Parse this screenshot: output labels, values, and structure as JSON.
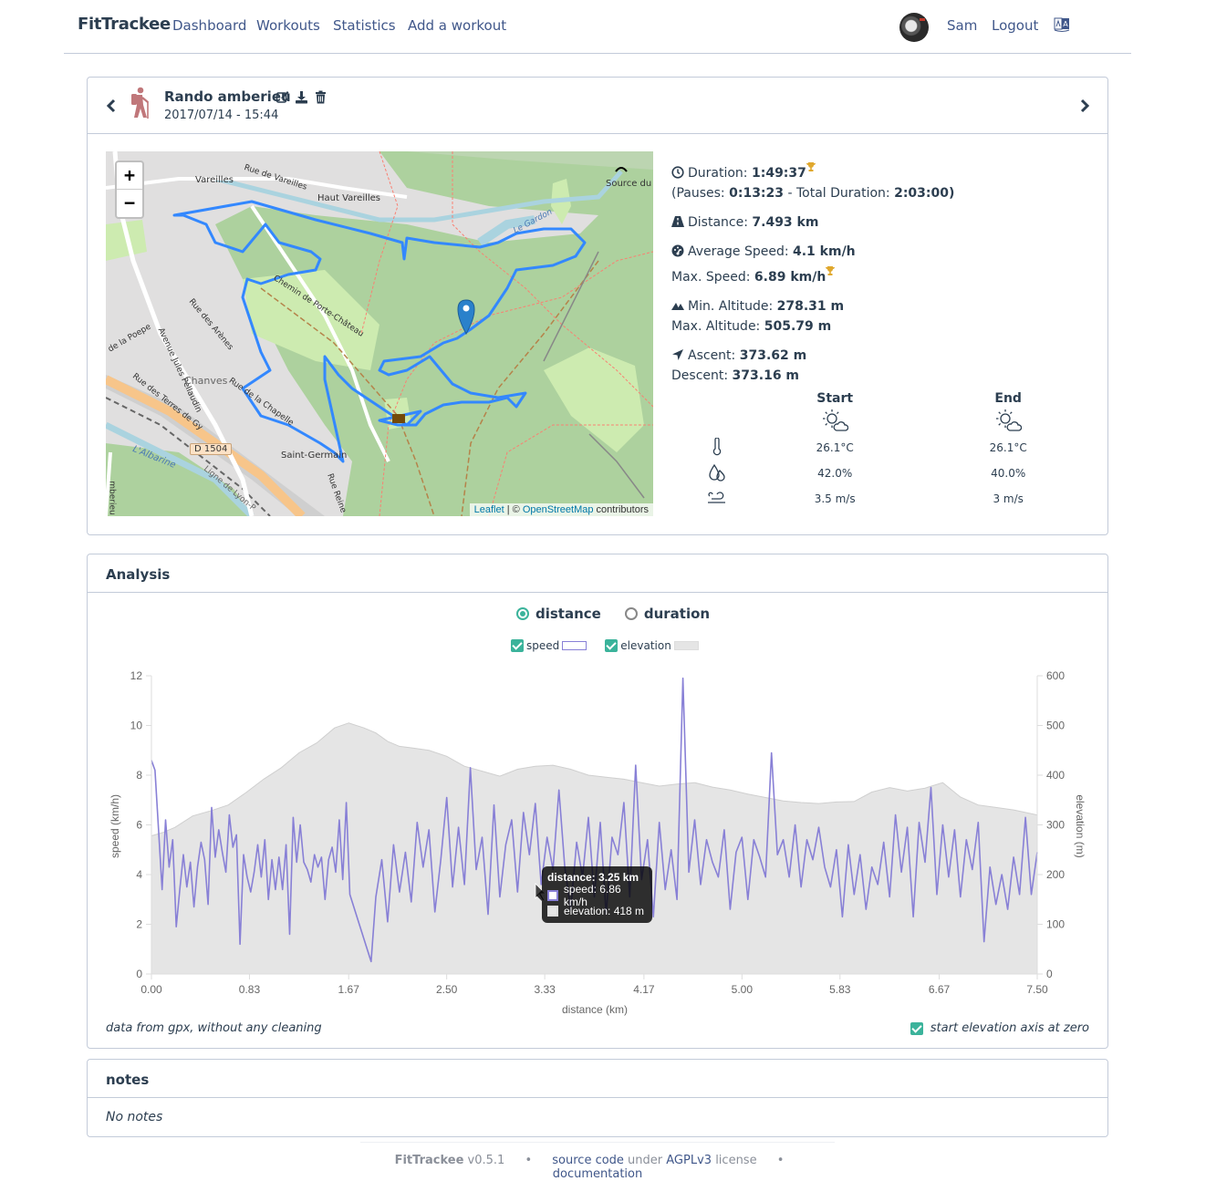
{
  "navbar": {
    "brand": "FitTrackee",
    "links": [
      "Dashboard",
      "Workouts",
      "Statistics",
      "Add a workout"
    ],
    "user": "Sam",
    "logout": "Logout",
    "language_icon": "language-icon"
  },
  "workout": {
    "title": "Rando amberieu",
    "date": "2017/07/14 - 15:44",
    "sport_icon": "hiking-icon",
    "actions": [
      "edit-icon",
      "download-icon",
      "delete-icon"
    ],
    "map": {
      "labels": [
        "Vareilles",
        "Rue de Vareilles",
        "Haut Vareilles",
        "Source du Gardon",
        "Le Gardon",
        "Chemin de Porte-Château",
        "Rue des Arènes",
        "de la Poepe",
        "Avenue Jules Pellaudin",
        "Chanves",
        "Rue des Terres de Gy",
        "Rue de la Chapelle",
        "Saint-Germain",
        "D 1504",
        "L'Albarine",
        "Ligne de Lyon-P",
        "Rue Reine",
        "mberieu"
      ],
      "zoom_in": "+",
      "zoom_out": "−",
      "attribution": {
        "leaflet": "Leaflet",
        "separator": " | © ",
        "osm": "OpenStreetMap",
        "suffix": " contributors"
      }
    },
    "stats": {
      "duration_label": "Duration: ",
      "duration": "1:49:37",
      "pauses_label": "(Pauses: ",
      "pauses": "0:13:23",
      "total_label": " - Total Duration: ",
      "total": "2:03:00",
      "close": ")",
      "distance_label": "Distance: ",
      "distance": "7.493 km",
      "avg_speed_label": "Average Speed: ",
      "avg_speed": "4.1 km/h",
      "max_speed_label": "Max. Speed: ",
      "max_speed": "6.89 km/h",
      "min_alt_label": "Min. Altitude: ",
      "min_alt": "278.31 m",
      "max_alt_label": "Max. Altitude: ",
      "max_alt": "505.79 m",
      "ascent_label": "Ascent: ",
      "ascent": "373.62 m",
      "descent_label": "Descent: ",
      "descent": "373.16 m"
    },
    "weather": {
      "start_label": "Start",
      "end_label": "End",
      "start": {
        "icon": "partly-cloudy-day-icon",
        "temperature": "26.1°C",
        "humidity": "42.0%",
        "wind": "3.5 m/s"
      },
      "end": {
        "icon": "partly-cloudy-day-icon",
        "temperature": "26.1°C",
        "humidity": "40.0%",
        "wind": "3 m/s"
      }
    }
  },
  "analysis": {
    "title": "Analysis",
    "x_modes": [
      {
        "label": "distance",
        "selected": true
      },
      {
        "label": "duration",
        "selected": false
      }
    ],
    "legend": [
      {
        "label": "speed",
        "checked": true,
        "color": "#8880d6"
      },
      {
        "label": "elevation",
        "checked": true,
        "color": "#e5e5e5"
      }
    ],
    "footnote": "data from gpx, without any cleaning",
    "elevation_zero_label": "start elevation axis at zero",
    "elevation_zero_checked": true,
    "tooltip": {
      "title": "distance: 3.25 km",
      "speed": "speed: 6.86 km/h",
      "elevation": "elevation: 418 m"
    }
  },
  "chart_data": {
    "type": "line",
    "xlabel": "distance (km)",
    "ylabel_left": "speed (km/h)",
    "ylabel_right": "elevation (m)",
    "x_ticks": [
      "0.00",
      "0.83",
      "1.67",
      "2.50",
      "3.33",
      "4.17",
      "5.00",
      "5.83",
      "6.67",
      "7.50"
    ],
    "y_left_ticks": [
      "0",
      "2",
      "4",
      "6",
      "8",
      "10",
      "12"
    ],
    "y_right_ticks": [
      "0",
      "100",
      "200",
      "300",
      "400",
      "500",
      "600"
    ],
    "xlim": [
      0,
      7.5
    ],
    "ylim_left": [
      0,
      12
    ],
    "ylim_right": [
      0,
      600
    ],
    "grid": false,
    "series": [
      {
        "name": "speed",
        "axis": "left",
        "color": "#8880d6",
        "x": [
          0,
          0.03,
          0.06,
          0.09,
          0.12,
          0.15,
          0.18,
          0.21,
          0.24,
          0.27,
          0.3,
          0.33,
          0.36,
          0.39,
          0.42,
          0.45,
          0.48,
          0.51,
          0.54,
          0.57,
          0.6,
          0.63,
          0.66,
          0.69,
          0.72,
          0.75,
          0.78,
          0.81,
          0.84,
          0.87,
          0.9,
          0.93,
          0.96,
          0.99,
          1.02,
          1.05,
          1.08,
          1.11,
          1.14,
          1.17,
          1.2,
          1.23,
          1.26,
          1.29,
          1.32,
          1.35,
          1.38,
          1.41,
          1.44,
          1.47,
          1.5,
          1.53,
          1.56,
          1.59,
          1.62,
          1.65,
          1.68,
          1.82,
          1.86,
          1.9,
          1.95,
          2.0,
          2.05,
          2.1,
          2.15,
          2.2,
          2.25,
          2.3,
          2.35,
          2.4,
          2.45,
          2.5,
          2.55,
          2.6,
          2.65,
          2.7,
          2.75,
          2.8,
          2.85,
          2.9,
          2.95,
          3.0,
          3.05,
          3.1,
          3.15,
          3.2,
          3.25,
          3.3,
          3.35,
          3.4,
          3.45,
          3.5,
          3.55,
          3.6,
          3.65,
          3.7,
          3.75,
          3.8,
          3.85,
          3.9,
          3.95,
          4.0,
          4.05,
          4.1,
          4.15,
          4.2,
          4.25,
          4.3,
          4.35,
          4.4,
          4.45,
          4.5,
          4.55,
          4.6,
          4.65,
          4.7,
          4.75,
          4.8,
          4.85,
          4.9,
          4.95,
          5.0,
          5.05,
          5.1,
          5.15,
          5.2,
          5.25,
          5.3,
          5.35,
          5.4,
          5.45,
          5.5,
          5.55,
          5.6,
          5.65,
          5.7,
          5.75,
          5.8,
          5.85,
          5.9,
          5.95,
          6.0,
          6.05,
          6.1,
          6.15,
          6.2,
          6.25,
          6.3,
          6.35,
          6.4,
          6.45,
          6.5,
          6.55,
          6.6,
          6.65,
          6.7,
          6.75,
          6.8,
          6.85,
          6.9,
          6.95,
          7.0,
          7.05,
          7.1,
          7.15,
          7.2,
          7.25,
          7.3,
          7.35,
          7.4,
          7.45,
          7.5
        ],
        "values": [
          8.6,
          8.2,
          5.8,
          3.4,
          6.2,
          4.3,
          5.4,
          1.9,
          3.4,
          4.8,
          3.5,
          4.5,
          2.7,
          4.3,
          5.3,
          4.6,
          2.8,
          6.7,
          4.7,
          5.8,
          4.9,
          4.1,
          6.4,
          5.1,
          5.6,
          1.2,
          4.8,
          3.9,
          3.3,
          4.1,
          5.2,
          3.9,
          5.4,
          3.0,
          4.6,
          3.4,
          4.7,
          3.4,
          5.2,
          1.6,
          6.3,
          4.5,
          6.0,
          4.5,
          4.2,
          3.7,
          4.8,
          4.3,
          4.7,
          3.0,
          4.6,
          5.1,
          4.1,
          6.2,
          3.8,
          6.9,
          3.2,
          1.1,
          0.5,
          3.1,
          4.6,
          2.1,
          5.2,
          3.3,
          4.9,
          2.9,
          6.1,
          4.3,
          5.8,
          2.5,
          4.6,
          7.1,
          3.5,
          5.9,
          3.6,
          8.3,
          4.2,
          5.5,
          2.4,
          6.8,
          3.1,
          5.2,
          6.2,
          3.3,
          6.5,
          4.8,
          6.86,
          3.6,
          5.5,
          4.2,
          7.4,
          4.3,
          2.6,
          5.3,
          3.9,
          6.3,
          3.1,
          6.1,
          2.4,
          5.5,
          4.8,
          6.9,
          3.1,
          8.4,
          3.8,
          5.4,
          2.3,
          6.1,
          3.4,
          5.0,
          3.0,
          11.9,
          4.1,
          6.2,
          3.6,
          5.4,
          4.5,
          3.9,
          5.8,
          2.6,
          4.9,
          5.5,
          3.0,
          5.4,
          4.7,
          3.9,
          8.9,
          4.8,
          5.4,
          3.9,
          6.0,
          3.5,
          5.4,
          4.6,
          5.9,
          4.3,
          3.5,
          5.0,
          2.3,
          5.2,
          3.2,
          4.8,
          2.6,
          4.3,
          3.6,
          5.3,
          3.1,
          6.4,
          4.1,
          5.9,
          2.3,
          6.1,
          4.5,
          7.5,
          3.2,
          6.0,
          3.9,
          5.8,
          3.1,
          5.4,
          4.2,
          6.1,
          1.3,
          4.3,
          2.8,
          4.0,
          2.6,
          4.7,
          3.2,
          6.3,
          3.2,
          4.9,
          2.7,
          5.5,
          3.5,
          6.0,
          5.2,
          6.4
        ]
      },
      {
        "name": "elevation",
        "axis": "right",
        "color": "#e5e5e5",
        "x": [
          0,
          0.1,
          0.2,
          0.35,
          0.5,
          0.65,
          0.8,
          0.95,
          1.1,
          1.25,
          1.4,
          1.55,
          1.67,
          1.8,
          1.9,
          2.0,
          2.1,
          2.2,
          2.35,
          2.5,
          2.65,
          2.8,
          2.95,
          3.1,
          3.25,
          3.4,
          3.55,
          3.7,
          3.85,
          4.0,
          4.15,
          4.3,
          4.45,
          4.6,
          4.75,
          4.9,
          5.05,
          5.2,
          5.35,
          5.5,
          5.65,
          5.8,
          5.95,
          6.1,
          6.25,
          6.4,
          6.55,
          6.7,
          6.85,
          7.0,
          7.15,
          7.3,
          7.5
        ],
        "values": [
          278,
          285,
          295,
          318,
          328,
          340,
          365,
          392,
          415,
          445,
          465,
          495,
          505,
          495,
          485,
          468,
          458,
          455,
          450,
          438,
          418,
          408,
          398,
          412,
          418,
          420,
          412,
          400,
          396,
          392,
          385,
          378,
          382,
          385,
          376,
          370,
          362,
          355,
          348,
          345,
          343,
          346,
          347,
          366,
          375,
          368,
          374,
          385,
          356,
          340,
          335,
          330,
          320
        ]
      }
    ]
  },
  "notes": {
    "title": "notes",
    "body": "No notes"
  },
  "footer": {
    "brand": "FitTrackee",
    "version": " v0.5.1",
    "bullet": "•",
    "source_code": "source code",
    "under": " under ",
    "license": "AGPLv3",
    "license_suffix": " license",
    "documentation": "documentation"
  }
}
